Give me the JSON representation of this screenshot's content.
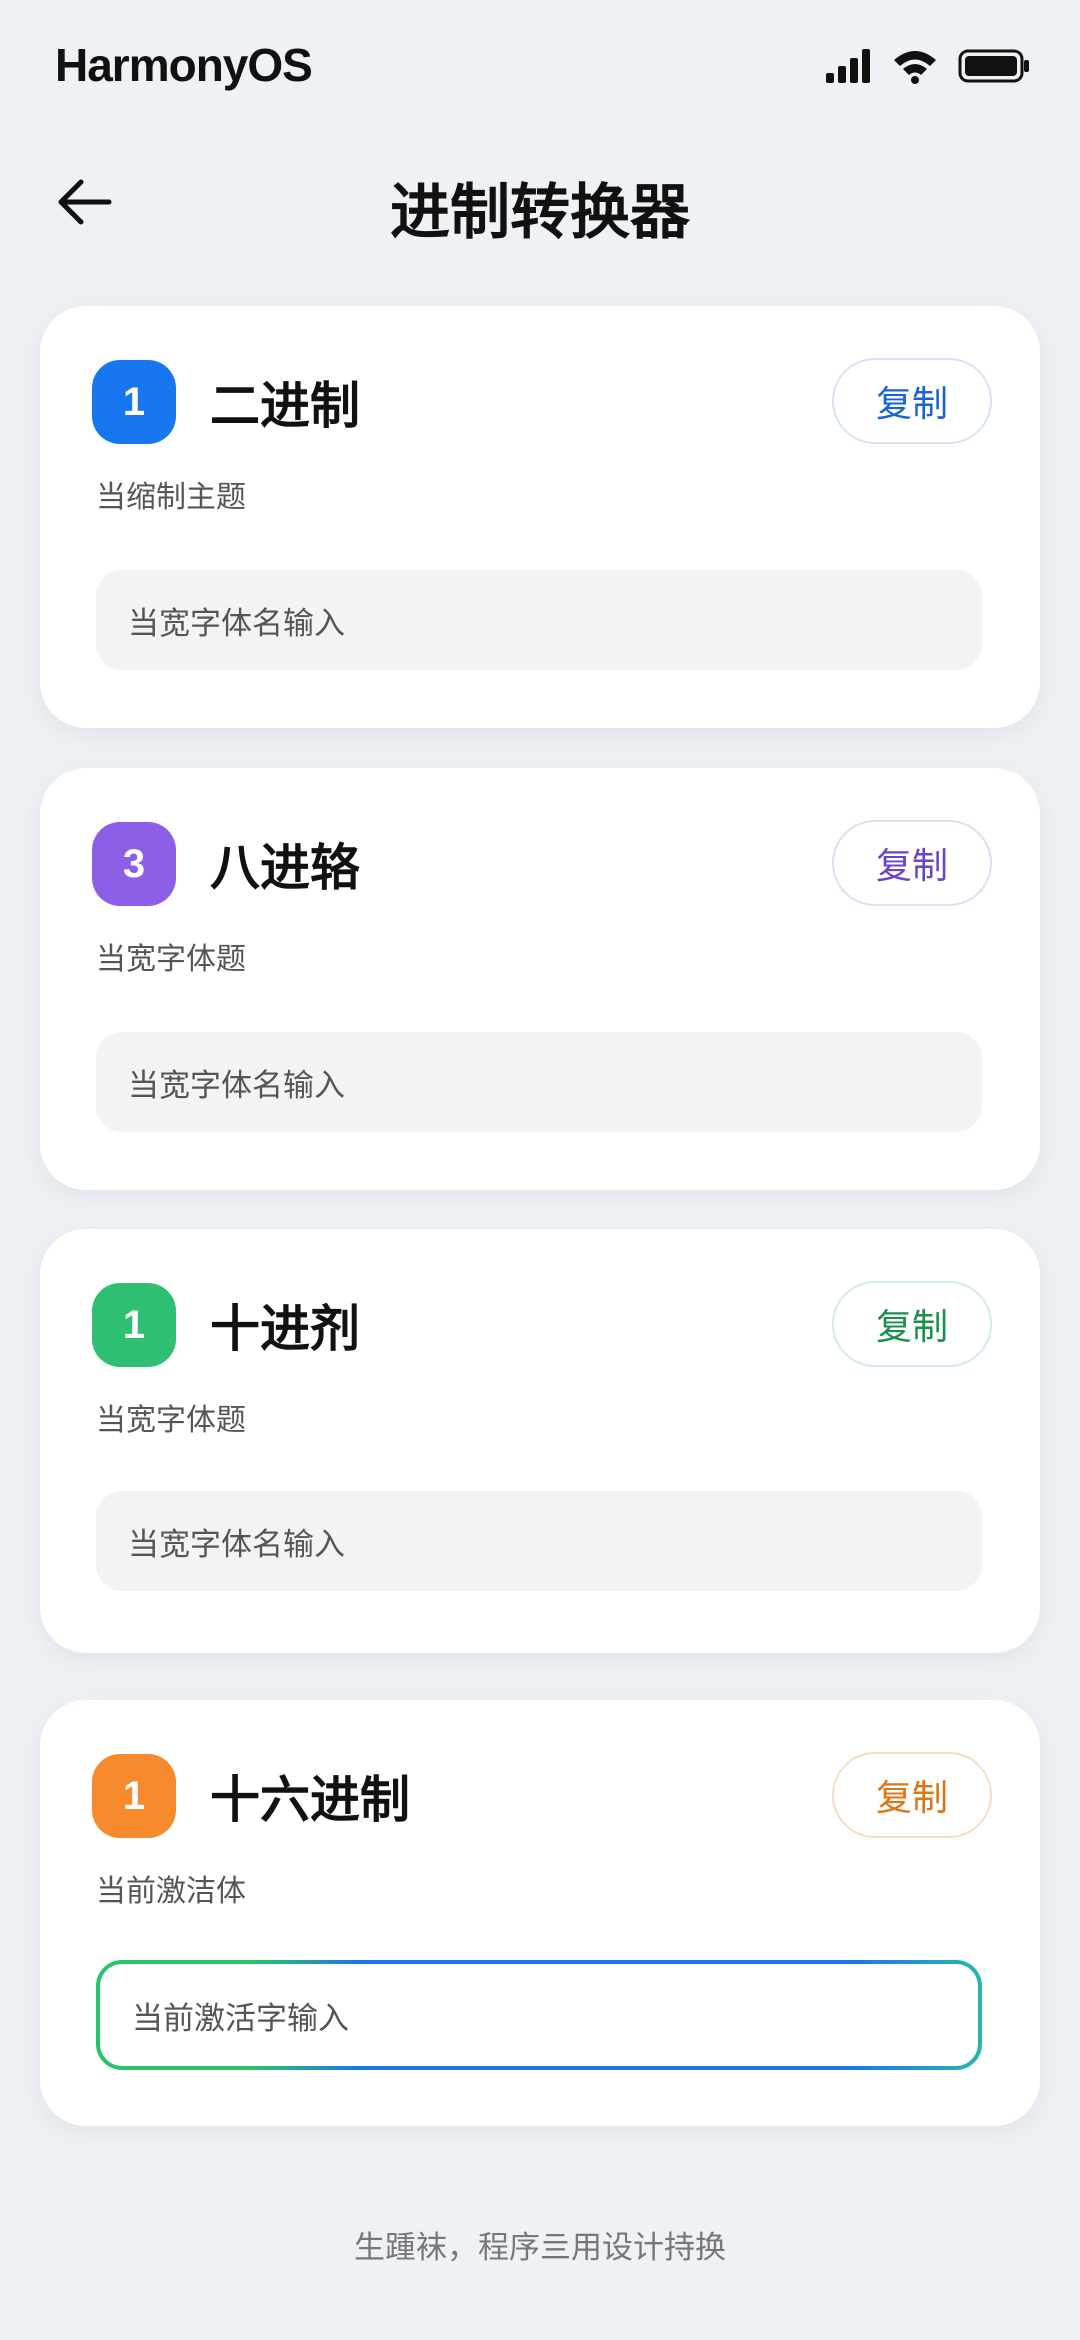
{
  "status_bar": {
    "brand": "HarmonyOS",
    "icons": [
      "signal-icon",
      "wifi-icon",
      "battery-icon"
    ]
  },
  "header": {
    "back_icon": "back-arrow-icon",
    "title": "进制转换器"
  },
  "cards": [
    {
      "badge": "1",
      "badge_color": "#1677f0",
      "title": "二进制",
      "subtitle": "当缩制主题",
      "copy_label": "复制",
      "copy_color": "#1a63d6",
      "input_placeholder": "当宽字体名输入"
    },
    {
      "badge": "3",
      "badge_color": "#8d5fe6",
      "title": "八进辂",
      "subtitle": "当宽字体题",
      "copy_label": "复制",
      "copy_color": "#6a44c9",
      "input_placeholder": "当宽字体名输入"
    },
    {
      "badge": "1",
      "badge_color": "#2fbf73",
      "title": "十进剂",
      "subtitle": "当宽字体题",
      "copy_label": "复制",
      "copy_color": "#1a8f4e",
      "input_placeholder": "当宽字体名输入"
    },
    {
      "badge": "1",
      "badge_color": "#f78a2c",
      "title": "十六进制",
      "subtitle": "当前激洁体",
      "copy_label": "复制",
      "copy_color": "#e07414",
      "input_placeholder": "当前激活字输入"
    }
  ],
  "footer": {
    "text": "生踵袜，程序亖用设计持换"
  }
}
